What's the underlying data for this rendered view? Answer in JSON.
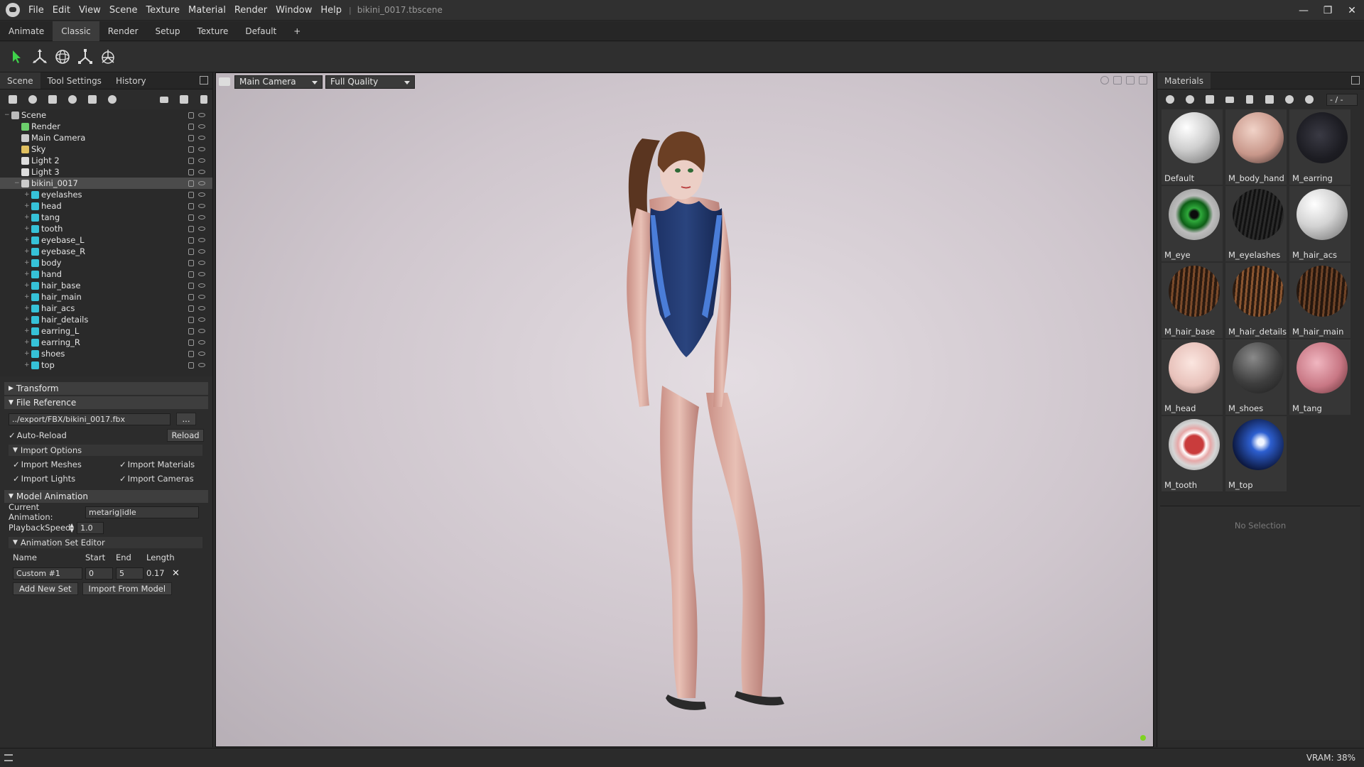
{
  "menubar": {
    "items": [
      "File",
      "Edit",
      "View",
      "Scene",
      "Texture",
      "Material",
      "Render",
      "Window",
      "Help"
    ],
    "separator": "|",
    "document_title": "bikini_0017.tbscene"
  },
  "window_controls": {
    "minimize": "—",
    "restore": "❐",
    "close": "✕"
  },
  "layout_tabs": [
    "Animate",
    "Classic",
    "Render",
    "Setup",
    "Texture",
    "Default",
    "+"
  ],
  "layout_tabs_active": "Classic",
  "toolbar": {
    "tools": [
      "select-arrow-icon",
      "move-gizmo-icon",
      "rotate-gizmo-icon",
      "scale-gizmo-icon",
      "transform-all-icon"
    ]
  },
  "left_panel": {
    "tabs": [
      "Scene",
      "Tool Settings",
      "History"
    ],
    "tree": [
      {
        "label": "Scene",
        "depth": 0,
        "icon": "scene-icon",
        "color": "#bbbbbb"
      },
      {
        "label": "Render",
        "depth": 1,
        "icon": "render-icon",
        "color": "#6ccf6c"
      },
      {
        "label": "Main Camera",
        "depth": 1,
        "icon": "camera-icon",
        "color": "#cccccc"
      },
      {
        "label": "Sky",
        "depth": 1,
        "icon": "sky-icon",
        "color": "#e0c060"
      },
      {
        "label": "Light 2",
        "depth": 1,
        "icon": "light-icon",
        "color": "#dddddd"
      },
      {
        "label": "Light 3",
        "depth": 1,
        "icon": "light-icon",
        "color": "#dddddd"
      },
      {
        "label": "bikini_0017",
        "depth": 1,
        "icon": "model-icon",
        "color": "#cccccc",
        "selected": true
      },
      {
        "label": "eyelashes",
        "depth": 2,
        "icon": "mesh-icon",
        "color": "#36c2d8"
      },
      {
        "label": "head",
        "depth": 2,
        "icon": "mesh-icon",
        "color": "#36c2d8"
      },
      {
        "label": "tang",
        "depth": 2,
        "icon": "mesh-icon",
        "color": "#36c2d8"
      },
      {
        "label": "tooth",
        "depth": 2,
        "icon": "mesh-icon",
        "color": "#36c2d8"
      },
      {
        "label": "eyebase_L",
        "depth": 2,
        "icon": "mesh-icon",
        "color": "#36c2d8"
      },
      {
        "label": "eyebase_R",
        "depth": 2,
        "icon": "mesh-icon",
        "color": "#36c2d8"
      },
      {
        "label": "body",
        "depth": 2,
        "icon": "mesh-icon",
        "color": "#36c2d8"
      },
      {
        "label": "hand",
        "depth": 2,
        "icon": "mesh-icon",
        "color": "#36c2d8"
      },
      {
        "label": "hair_base",
        "depth": 2,
        "icon": "mesh-icon",
        "color": "#36c2d8"
      },
      {
        "label": "hair_main",
        "depth": 2,
        "icon": "mesh-icon",
        "color": "#36c2d8"
      },
      {
        "label": "hair_acs",
        "depth": 2,
        "icon": "mesh-icon",
        "color": "#36c2d8"
      },
      {
        "label": "hair_details",
        "depth": 2,
        "icon": "mesh-icon",
        "color": "#36c2d8"
      },
      {
        "label": "earring_L",
        "depth": 2,
        "icon": "mesh-icon",
        "color": "#36c2d8"
      },
      {
        "label": "earring_R",
        "depth": 2,
        "icon": "mesh-icon",
        "color": "#36c2d8"
      },
      {
        "label": "shoes",
        "depth": 2,
        "icon": "mesh-icon",
        "color": "#36c2d8"
      },
      {
        "label": "top",
        "depth": 2,
        "icon": "mesh-icon",
        "color": "#36c2d8"
      }
    ],
    "transform_header": "Transform",
    "file_reference_header": "File Reference",
    "file_path": "../export/FBX/bikini_0017.fbx",
    "browse_label": "...",
    "auto_reload_label": "Auto-Reload",
    "reload_label": "Reload",
    "import_options_header": "Import Options",
    "import_meshes": "Import Meshes",
    "import_materials": "Import Materials",
    "import_lights": "Import Lights",
    "import_cameras": "Import Cameras",
    "model_animation_header": "Model Animation",
    "current_animation_label": "Current Animation:",
    "current_animation_value": "metarig|idle",
    "playback_speed_label": "PlaybackSpeed",
    "playback_speed_value": "1.0",
    "anim_set_editor_header": "Animation Set Editor",
    "anim_cols": {
      "name": "Name",
      "start": "Start",
      "end": "End",
      "length": "Length"
    },
    "anim_row": {
      "name": "Custom #1",
      "start": "0",
      "end": "5",
      "length": "0.17",
      "delete": "✕"
    },
    "add_new_set_label": "Add New Set",
    "import_from_model_label": "Import From Model"
  },
  "viewport": {
    "camera_select": "Main Camera",
    "quality_select": "Full Quality"
  },
  "right_panel": {
    "title": "Materials",
    "counter": "- / -",
    "materials": [
      {
        "name": "Default",
        "sphere": "radial-gradient(circle at 35% 30%, #ffffff, #cfcfcf 45%, #6a6a6a 100%)"
      },
      {
        "name": "M_body_hand",
        "sphere": "radial-gradient(circle at 40% 35%, #f1d3c8, #c8978a 55%, #3a2a28 100%)"
      },
      {
        "name": "M_earring",
        "sphere": "radial-gradient(circle at 45% 45%, #3a3a44, #1c1c22 60%, #151518 100%)"
      },
      {
        "name": "M_eye",
        "sphere": "radial-gradient(circle at 50% 50%, #0c0c0c 10%, #2faa3b 18%, #0e5e17 38%, #bdbdbd 52%, #8c8c8c 100%)"
      },
      {
        "name": "M_eyelashes",
        "sphere": "repeating-linear-gradient(100deg, #111 0 3px, #2a2a2a 3px 6px)"
      },
      {
        "name": "M_hair_acs",
        "sphere": "radial-gradient(circle at 35% 30%, #ffffff, #d3d3d3 45%, #6a6a6a 100%)"
      },
      {
        "name": "M_hair_base",
        "sphere": "repeating-linear-gradient(95deg, #7a4a2a 0 3px, #2a1a10 3px 7px)"
      },
      {
        "name": "M_hair_details",
        "sphere": "repeating-linear-gradient(95deg, #8a5530 0 3px, #2c1b10 3px 7px)"
      },
      {
        "name": "M_hair_main",
        "sphere": "repeating-linear-gradient(95deg, #6e4327 0 3px, #26170e 3px 7px)"
      },
      {
        "name": "M_head",
        "sphere": "radial-gradient(circle at 45% 40%, #fbe6e0, #e8c2bb 55%, #7a5a55 100%)"
      },
      {
        "name": "M_shoes",
        "sphere": "radial-gradient(circle at 40% 30%, #8a8a8a, #3e3e3e 55%, #1a1a1a 100%)"
      },
      {
        "name": "M_tang",
        "sphere": "radial-gradient(circle at 40% 40%, #f0b6c0, #c87784 55%, #5a2a30 100%)"
      },
      {
        "name": "M_tooth",
        "sphere": "radial-gradient(circle at 50% 50%, #c93c3c 25%, #ffffff 33%, #e6a7a7 45%, #d6d6d6 60%, #7a7a7a 100%)"
      },
      {
        "name": "M_top",
        "sphere": "radial-gradient(circle at 55% 45%, #f0f5ff 8%, #2d5fd0 25%, #0d1a44 70%, #071026 100%)"
      }
    ],
    "no_selection": "No Selection"
  },
  "statusbar": {
    "vram": "VRAM: 38%"
  }
}
